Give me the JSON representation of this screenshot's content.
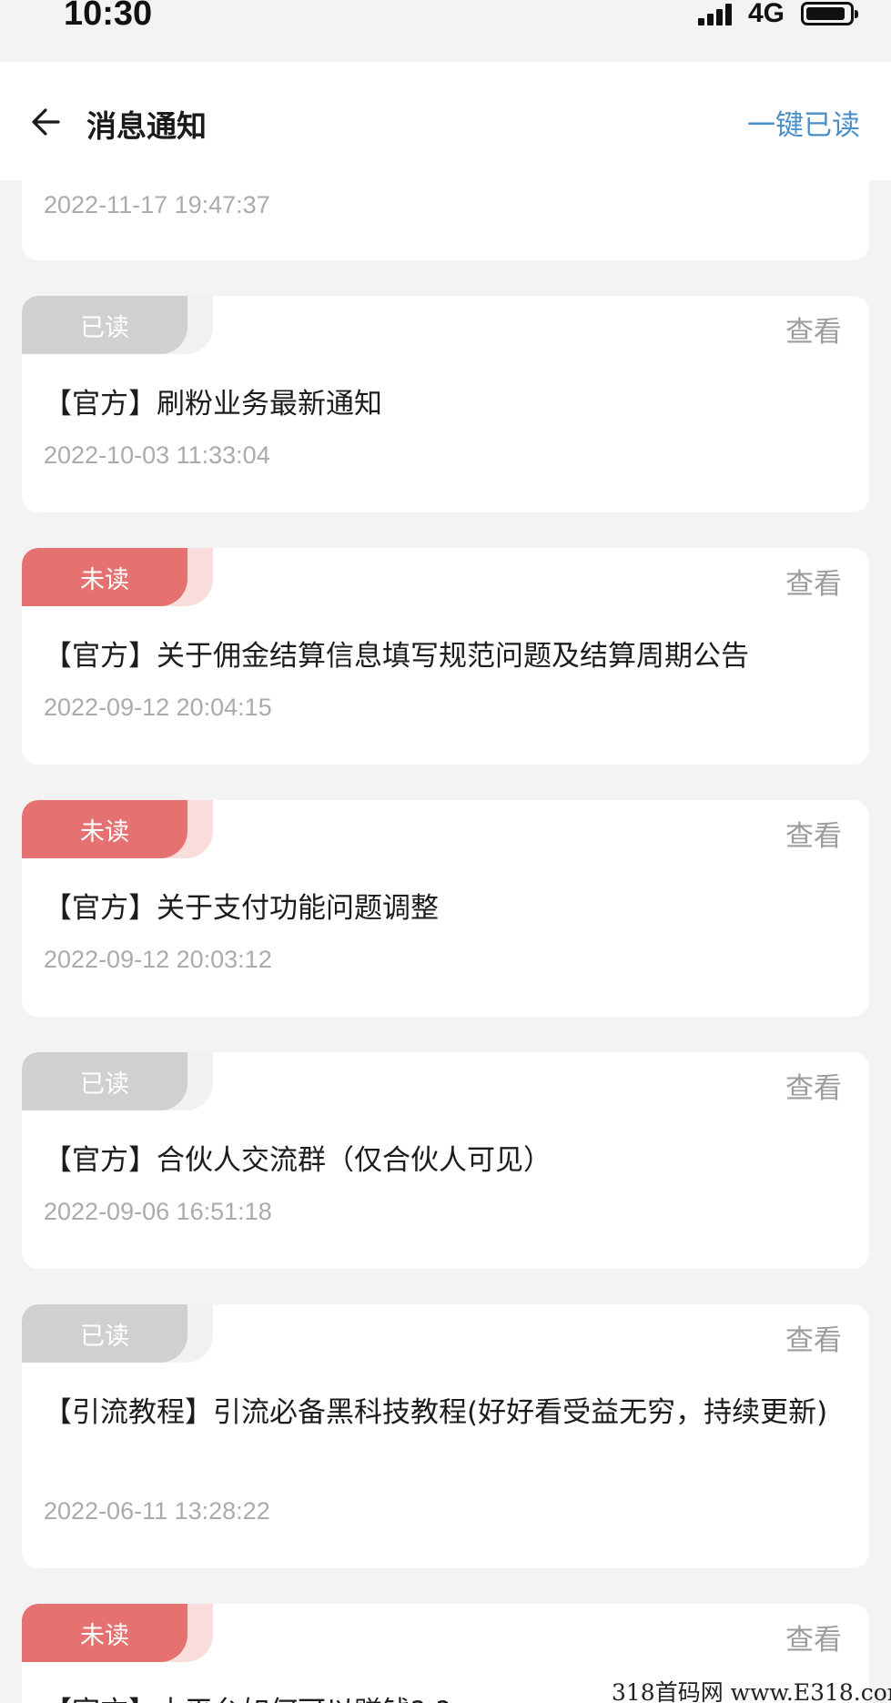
{
  "status_bar": {
    "time": "10:30",
    "network": "4G"
  },
  "header": {
    "title": "消息通知",
    "action": "一键已读"
  },
  "partial_card": {
    "time": "2022-11-17 19:47:37"
  },
  "messages": [
    {
      "status": "已读",
      "view": "查看",
      "title": "【官方】刷粉业务最新通知",
      "time": "2022-10-03 11:33:04"
    },
    {
      "status": "未读",
      "view": "查看",
      "title": "【官方】关于佣金结算信息填写规范问题及结算周期公告",
      "time": "2022-09-12 20:04:15"
    },
    {
      "status": "未读",
      "view": "查看",
      "title": "【官方】关于支付功能问题调整",
      "time": "2022-09-12 20:03:12"
    },
    {
      "status": "已读",
      "view": "查看",
      "title": "【官方】合伙人交流群（仅合伙人可见）",
      "time": "2022-09-06 16:51:18"
    },
    {
      "status": "已读",
      "view": "查看",
      "title": "【引流教程】引流必备黑科技教程(好好看受益无穷，持续更新)",
      "time": "2022-06-11 13:28:22"
    },
    {
      "status": "未读",
      "view": "查看",
      "title": "【官方】本平台如何可以赚钱?-?",
      "time": ""
    }
  ],
  "watermark": "318首码网 www.E318.com",
  "colors": {
    "accent": "#4a90c8",
    "unread": "#e67171",
    "read": "#d0d0d2"
  }
}
